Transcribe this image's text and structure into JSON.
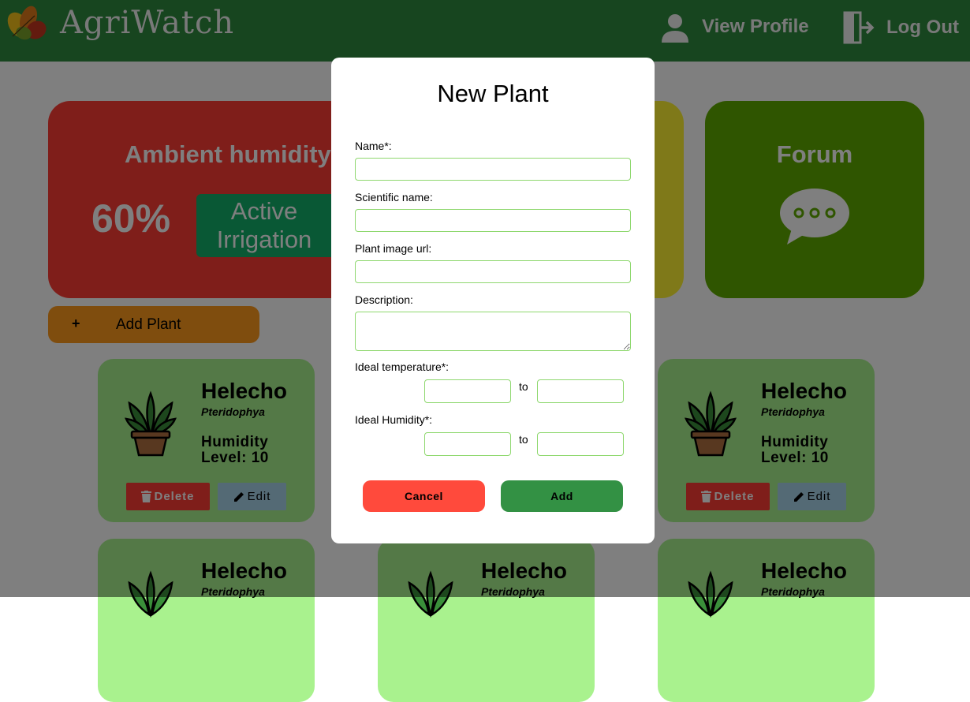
{
  "header": {
    "title": "AgriWatch",
    "view_profile": "View Profile",
    "log_out": "Log Out"
  },
  "dashboard": {
    "humidity_card": {
      "title": "Ambient humidity",
      "value": "60%",
      "irrigation_line1": "Active",
      "irrigation_line2": "Irrigation"
    },
    "forum_card": {
      "title": "Forum"
    },
    "add_plant": {
      "plus": "+",
      "label": "Add Plant"
    }
  },
  "plants": [
    {
      "name": "Helecho",
      "scientific": "Pteridophya",
      "humidity_line1": "Humidity",
      "humidity_line2": "Level: 10",
      "delete": "Delete",
      "edit": "Edit"
    },
    {
      "name": "Helecho",
      "scientific": "Pteridophya",
      "humidity_line1": "Humidity",
      "humidity_line2": "Level: 10",
      "delete": "Delete",
      "edit": "Edit"
    },
    {
      "name": "Helecho",
      "scientific": "Pteridophya"
    },
    {
      "name": "Helecho",
      "scientific": "Pteridophya"
    },
    {
      "name": "Helecho",
      "scientific": "Pteridophya"
    }
  ],
  "modal": {
    "title": "New Plant",
    "name_label": "Name*:",
    "name_value": "",
    "scientific_label": "Scientific name:",
    "scientific_value": "",
    "image_url_label": "Plant image url:",
    "image_url_value": "",
    "description_label": "Description:",
    "description_value": "",
    "temperature_label": "Ideal temperature*:",
    "temperature_to": "to",
    "humidity_label": "Ideal Humidity*:",
    "humidity_to": "to",
    "cancel": "Cancel",
    "add": "Add"
  },
  "colors": {
    "header": "#2e8b3e",
    "humidity_card": "#ff3c35",
    "forum_card": "#5fab00",
    "yellow_card": "#fff233",
    "add_plant": "#ff9a1c",
    "plant_card": "#a9f28e",
    "input_border": "#8fd86f",
    "cancel": "#ff4a3c",
    "add": "#339144"
  }
}
